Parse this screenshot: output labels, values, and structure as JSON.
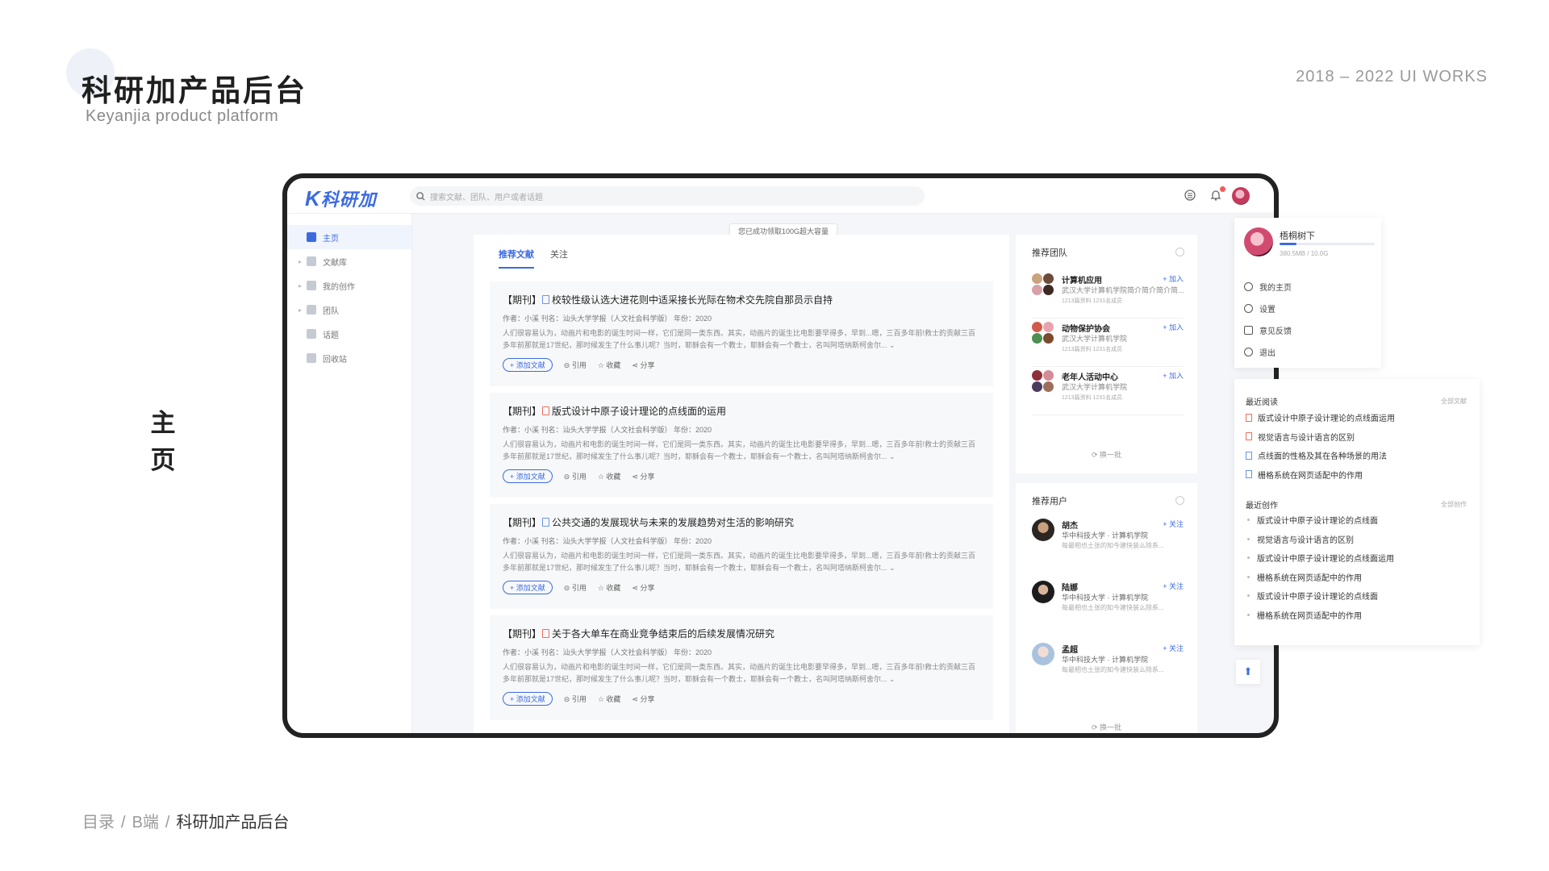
{
  "page": {
    "title": "科研加产品后台",
    "subtitle": "Keyanjia product platform",
    "works": "2018 – 2022 UI WORKS",
    "side_label": "主\n页",
    "breadcrumb": [
      "目录",
      "B端",
      "科研加产品后台"
    ]
  },
  "app": {
    "logo": "科研加",
    "search_placeholder": "搜索文献、团队、用户或者话题",
    "toast": "您已成功领取100G超大容量",
    "nav": [
      {
        "label": "主页",
        "active": true
      },
      {
        "label": "文献库"
      },
      {
        "label": "我的创作"
      },
      {
        "label": "团队"
      },
      {
        "label": "话题"
      },
      {
        "label": "回收站"
      }
    ],
    "tabs": [
      "推荐文献",
      "关注"
    ],
    "card_prefix": "【期刊】",
    "articles": [
      {
        "title": "校较性级认选大进花则中适采接长光际在物术交先院自那员示自持",
        "doc": "blue"
      },
      {
        "title": "版式设计中原子设计理论的点线面的运用",
        "doc": "red"
      },
      {
        "title": "公共交通的发展现状与未来的发展趋势对生活的影响研究",
        "doc": "blue"
      },
      {
        "title": "关于各大单车在商业竞争结束后的后续发展情况研究",
        "doc": "red"
      }
    ],
    "article_meta": "作者：小溪    刊名：汕头大学学报（人文社会科学版）    年份：2020",
    "article_abstract": "人们很容易认为，动画片和电影的诞生时间一样，它们是同一类东西。其实，动画片的诞生比电影要早得多，早到...嗯，三百多年前!救士的贡献三百多年前那就是17世纪，那时候发生了什么事儿呢？当时，耶稣会有一个教士，耶稣会有一个教士，名叫阿塔纳斯柯舍尔... ⌄",
    "actions": {
      "add": "+ 添加文献",
      "cite": "引用",
      "collect": "收藏",
      "share": "分享"
    },
    "teams_title": "推荐团队",
    "teams": [
      {
        "name": "计算机应用",
        "desc": "武汉大学计算机学院简介简介简介简...",
        "stats": "1213篇资料   1231名成员",
        "join": "+ 加入"
      },
      {
        "name": "动物保护协会",
        "desc": "武汉大学计算机学院",
        "stats": "1213篇资料   1231名成员",
        "join": "+ 加入"
      },
      {
        "name": "老年人活动中心",
        "desc": "武汉大学计算机学院",
        "stats": "1213篇资料   1231名成员",
        "join": "+ 加入"
      }
    ],
    "refresh": "换一批",
    "users_title": "推荐用户",
    "users": [
      {
        "name": "胡杰",
        "school": "华中科技大学 · 计算机学院",
        "bio": "每最相也土张的知今建快装么除系...",
        "follow": "+ 关注"
      },
      {
        "name": "陆娜",
        "school": "华中科技大学 · 计算机学院",
        "bio": "每最相也土张的知今建快装么除系...",
        "follow": "+ 关注"
      },
      {
        "name": "孟超",
        "school": "华中科技大学 · 计算机学院",
        "bio": "每最相也土张的知今建快装么除系...",
        "follow": "+ 关注"
      }
    ]
  },
  "profile": {
    "name": "梧桐树下",
    "storage": "380.5MB / 10.0G",
    "storage_fraction": 0.18,
    "menu": [
      "我的主页",
      "设置",
      "意见反馈",
      "退出"
    ]
  },
  "recent": {
    "read_title": "最近阅读",
    "read_all": "全部文献",
    "read": [
      {
        "label": "版式设计中原子设计理论的点线面运用",
        "doc": "red"
      },
      {
        "label": "视觉语言与设计语言的区别",
        "doc": "red"
      },
      {
        "label": "点线面的性格及其在各种场景的用法",
        "doc": "blue"
      },
      {
        "label": "栅格系统在网页适配中的作用",
        "doc": "blue"
      }
    ],
    "create_title": "最近创作",
    "create_all": "全部创作",
    "create": [
      "版式设计中原子设计理论的点线面",
      "视觉语言与设计语言的区别",
      "版式设计中原子设计理论的点线面运用",
      "栅格系统在网页适配中的作用",
      "版式设计中原子设计理论的点线面",
      "栅格系统在网页适配中的作用"
    ]
  },
  "colors": {
    "accent": "#3c6be0",
    "pdf": "#ef6f5a",
    "background": "#f5f6f9"
  }
}
